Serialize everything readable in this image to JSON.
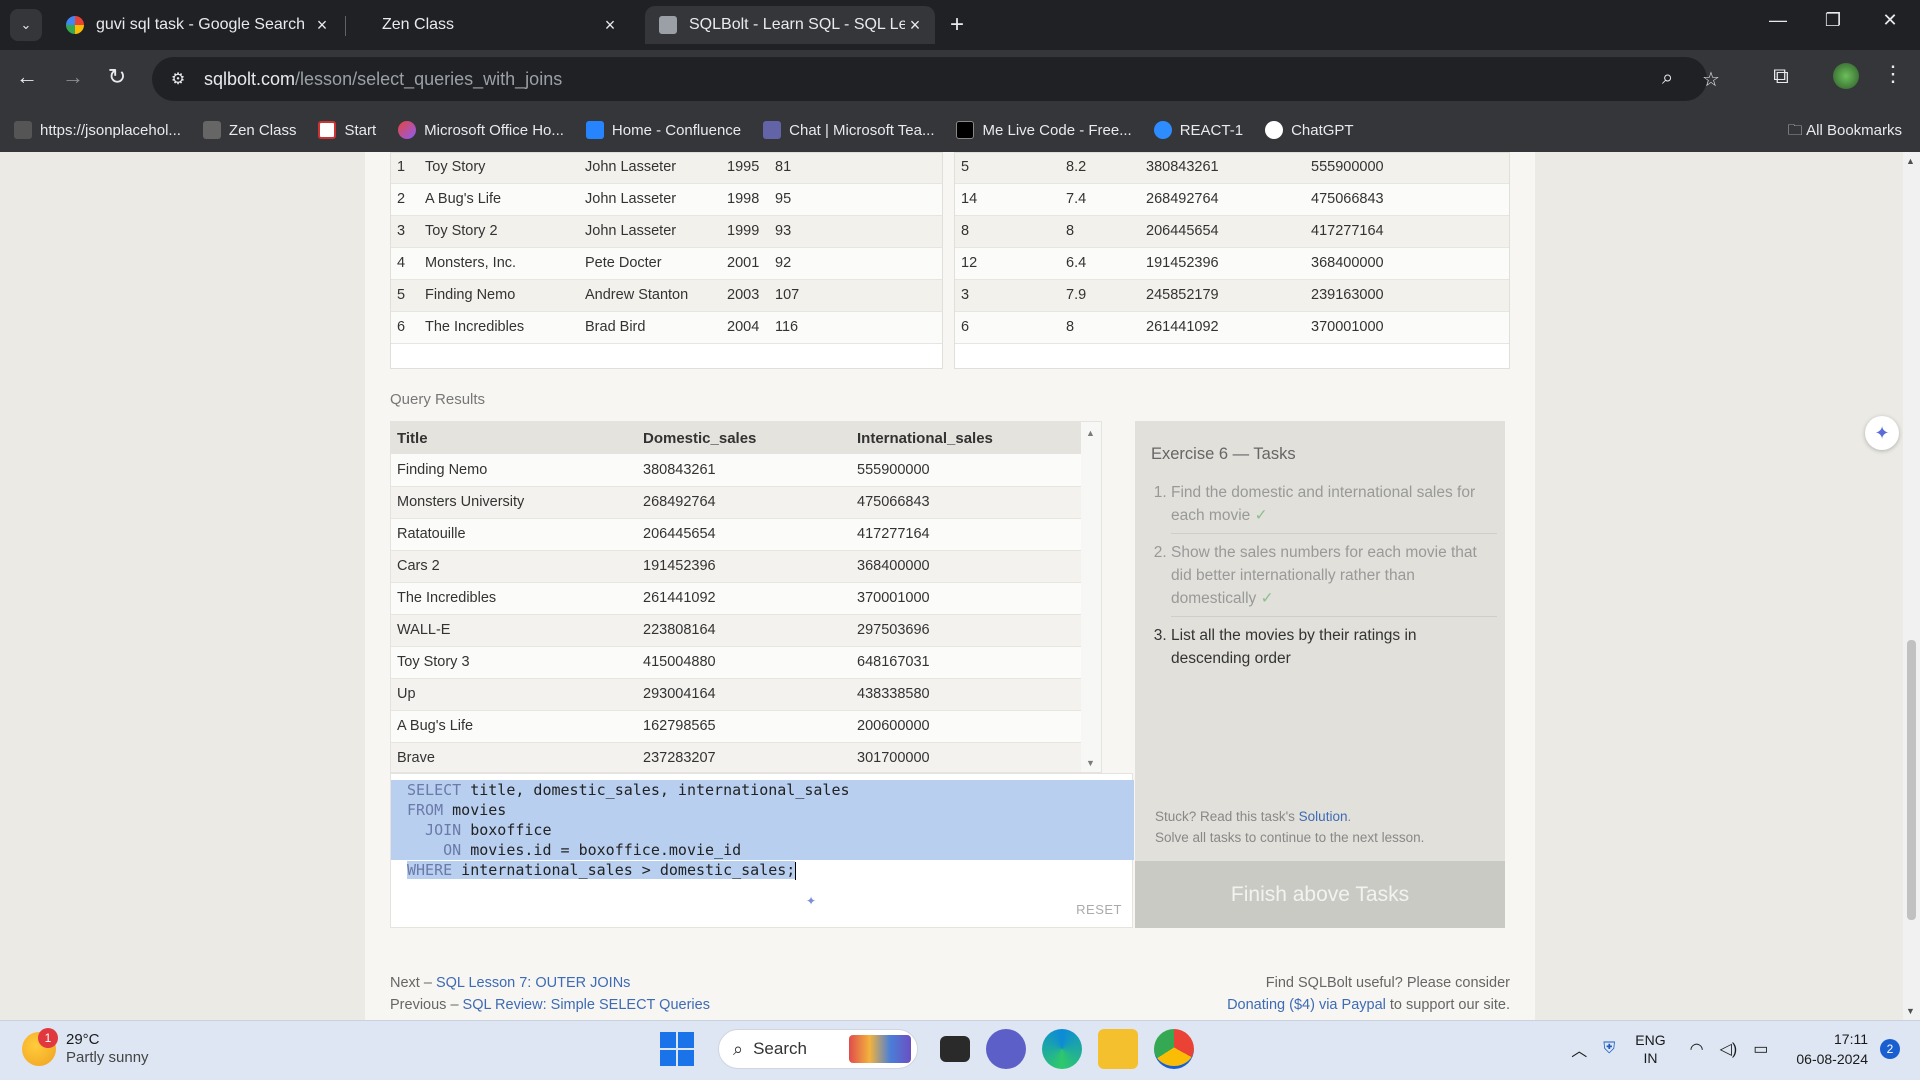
{
  "browser": {
    "tabs": [
      {
        "title": "guvi sql task - Google Search",
        "active": false
      },
      {
        "title": "Zen Class",
        "active": false
      },
      {
        "title": "SQLBolt - Learn SQL - SQL Lesson",
        "active": true
      }
    ],
    "url_host": "sqlbolt.com",
    "url_path": "/lesson/select_queries_with_joins",
    "bookmarks": [
      "https://jsonplacehol...",
      "Zen Class",
      "Start",
      "Microsoft Office Ho...",
      "Home - Confluence",
      "Chat | Microsoft Tea...",
      "Me Live Code - Free...",
      "REACT-1",
      "ChatGPT"
    ],
    "all_bookmarks": "All Bookmarks"
  },
  "movies_table": {
    "rows": [
      [
        "1",
        "Toy Story",
        "John Lasseter",
        "1995",
        "81"
      ],
      [
        "2",
        "A Bug's Life",
        "John Lasseter",
        "1998",
        "95"
      ],
      [
        "3",
        "Toy Story 2",
        "John Lasseter",
        "1999",
        "93"
      ],
      [
        "4",
        "Monsters, Inc.",
        "Pete Docter",
        "2001",
        "92"
      ],
      [
        "5",
        "Finding Nemo",
        "Andrew Stanton",
        "2003",
        "107"
      ],
      [
        "6",
        "The Incredibles",
        "Brad Bird",
        "2004",
        "116"
      ]
    ]
  },
  "boxoffice_table": {
    "rows": [
      [
        "5",
        "8.2",
        "380843261",
        "555900000"
      ],
      [
        "14",
        "7.4",
        "268492764",
        "475066843"
      ],
      [
        "8",
        "8",
        "206445654",
        "417277164"
      ],
      [
        "12",
        "6.4",
        "191452396",
        "368400000"
      ],
      [
        "3",
        "7.9",
        "245852179",
        "239163000"
      ],
      [
        "6",
        "8",
        "261441092",
        "370001000"
      ]
    ]
  },
  "query_results": {
    "label": "Query Results",
    "columns": [
      "Title",
      "Domestic_sales",
      "International_sales"
    ],
    "rows": [
      [
        "Finding Nemo",
        "380843261",
        "555900000"
      ],
      [
        "Monsters University",
        "268492764",
        "475066843"
      ],
      [
        "Ratatouille",
        "206445654",
        "417277164"
      ],
      [
        "Cars 2",
        "191452396",
        "368400000"
      ],
      [
        "The Incredibles",
        "261441092",
        "370001000"
      ],
      [
        "WALL-E",
        "223808164",
        "297503696"
      ],
      [
        "Toy Story 3",
        "415004880",
        "648167031"
      ],
      [
        "Up",
        "293004164",
        "438338580"
      ],
      [
        "A Bug's Life",
        "162798565",
        "200600000"
      ],
      [
        "Brave",
        "237283207",
        "301700000"
      ]
    ]
  },
  "editor": {
    "lines": [
      [
        "SELECT",
        " title, domestic_sales, international_sales"
      ],
      [
        "FROM",
        " movies"
      ],
      [
        "  JOIN",
        " boxoffice"
      ],
      [
        "    ON",
        " movies.id = boxoffice.movie_id"
      ],
      [
        "WHERE",
        " international_sales > domestic_sales;"
      ]
    ],
    "reset_label": "RESET"
  },
  "tasks": {
    "heading": "Exercise 6 — Tasks",
    "items": [
      {
        "text": "Find the domestic and international sales for each movie",
        "done": true
      },
      {
        "text": "Show the sales numbers for each movie that did better internationally rather than domestically",
        "done": true
      },
      {
        "text": "List all the movies by their ratings in descending order",
        "done": false
      }
    ],
    "check": "✓",
    "stuck_prefix": "Stuck? Read this task's",
    "solution_link": "Solution",
    "stuck_suffix": ".",
    "continue_text": "Solve all tasks to continue to the next lesson.",
    "finish_label": "Finish above Tasks"
  },
  "footer": {
    "next_prefix": "Next –",
    "next_link": "SQL Lesson 7: OUTER JOINs",
    "prev_prefix": "Previous –",
    "prev_link": "SQL Review: Simple SELECT Queries",
    "useful_text": "Find SQLBolt useful? Please consider",
    "donate_link": "Donating ($4) via Paypal",
    "donate_suffix": "to support our site."
  },
  "taskbar": {
    "weather_temp": "29°C",
    "weather_desc": "Partly sunny",
    "weather_badge": "1",
    "search_label": "Search",
    "lang_top": "ENG",
    "lang_bottom": "IN",
    "time": "17:11",
    "date": "06-08-2024",
    "notification_count": "2"
  },
  "colors": {
    "link": "#3d6bb5",
    "selection": "#b8cff0",
    "finish_button": "#cacac5"
  }
}
